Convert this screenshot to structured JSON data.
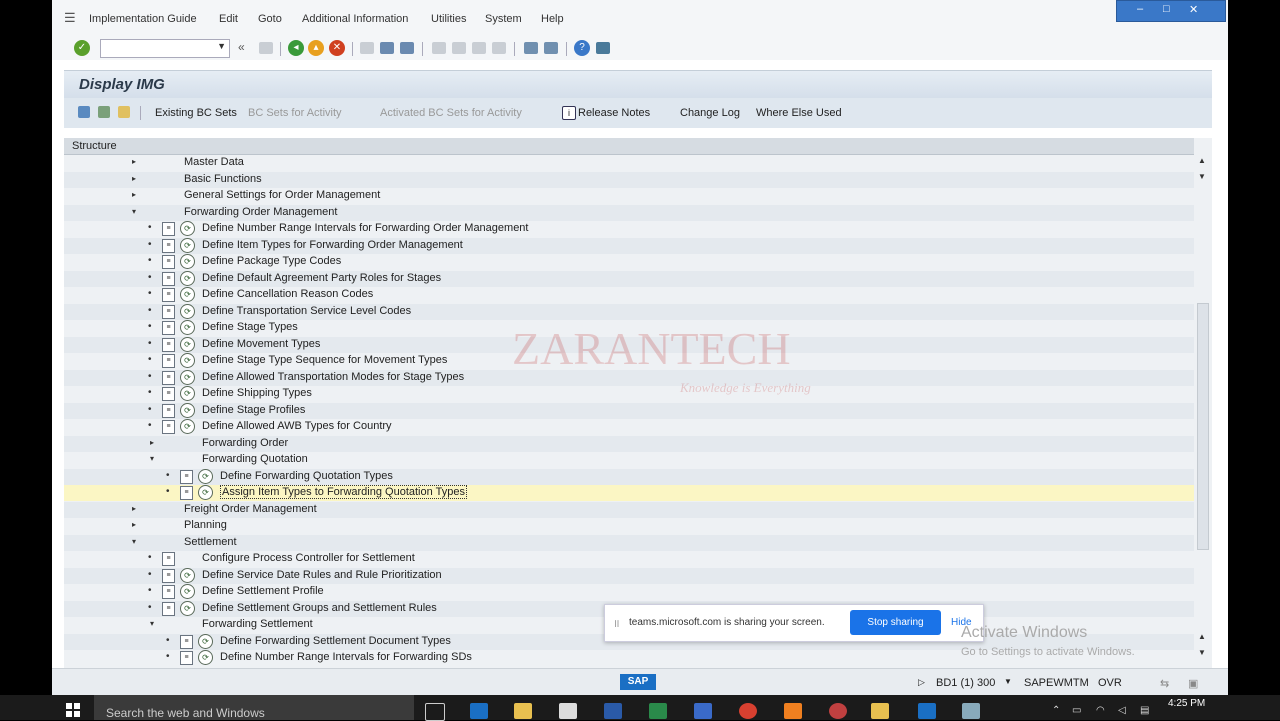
{
  "menu": [
    "Implementation Guide",
    "Edit",
    "Goto",
    "Additional Information",
    "Utilities",
    "System",
    "Help"
  ],
  "window_controls": [
    "–",
    "□",
    "✕"
  ],
  "title": "Display IMG",
  "app_toolbar": {
    "existing_bc_sets": "Existing BC Sets",
    "bc_sets_activity": "BC Sets for Activity",
    "activated_bc_sets": "Activated BC Sets for Activity",
    "release_notes": "Release Notes",
    "change_log": "Change Log",
    "where_else_used": "Where Else Used"
  },
  "structure_header": "Structure",
  "tree": [
    {
      "label": "Master Data",
      "toggle": "▸"
    },
    {
      "label": "Basic Functions",
      "toggle": "▸"
    },
    {
      "label": "General Settings for Order Management",
      "toggle": "▸"
    },
    {
      "label": "Forwarding Order Management",
      "toggle": "▾"
    },
    {
      "label": "Define Number Range Intervals for Forwarding Order Management"
    },
    {
      "label": "Define Item Types for Forwarding Order Management"
    },
    {
      "label": "Define Package Type Codes"
    },
    {
      "label": "Define Default Agreement Party Roles for Stages"
    },
    {
      "label": "Define Cancellation Reason Codes"
    },
    {
      "label": "Define Transportation Service Level Codes"
    },
    {
      "label": "Define Stage Types"
    },
    {
      "label": "Define Movement Types"
    },
    {
      "label": "Define Stage Type Sequence for Movement Types"
    },
    {
      "label": "Define Allowed Transportation Modes for Stage Types"
    },
    {
      "label": "Define Shipping Types"
    },
    {
      "label": "Define Stage Profiles"
    },
    {
      "label": "Define Allowed AWB Types for Country"
    },
    {
      "label": "Forwarding Order",
      "toggle": "▸"
    },
    {
      "label": "Forwarding Quotation",
      "toggle": "▾"
    },
    {
      "label": "Define Forwarding Quotation Types"
    },
    {
      "label": "Assign Item Types to Forwarding Quotation Types"
    },
    {
      "label": "Freight Order Management",
      "toggle": "▸"
    },
    {
      "label": "Planning",
      "toggle": "▸"
    },
    {
      "label": "Settlement",
      "toggle": "▾"
    },
    {
      "label": "Configure Process Controller for Settlement"
    },
    {
      "label": "Define Service Date Rules and Rule Prioritization"
    },
    {
      "label": "Define Settlement Profile"
    },
    {
      "label": "Define Settlement Groups and Settlement Rules"
    },
    {
      "label": "Forwarding Settlement",
      "toggle": "▾"
    },
    {
      "label": "Define Forwarding Settlement Document Types"
    },
    {
      "label": "Define Number Range Intervals for Forwarding SDs"
    }
  ],
  "watermark": {
    "brand": "ZARANTECH",
    "tagline": "Knowledge is Everything"
  },
  "status": {
    "sap_logo": "SAP",
    "system": "BD1 (1) 300",
    "server": "SAPEWMTM",
    "mode": "OVR"
  },
  "share_bar": {
    "message": "teams.microsoft.com is sharing your screen.",
    "stop": "Stop sharing",
    "hide": "Hide"
  },
  "activate_windows": {
    "title": "Activate Windows",
    "subtitle": "Go to Settings to activate Windows."
  },
  "taskbar": {
    "search_placeholder": "Search the web and Windows",
    "time": "4:25 PM"
  },
  "colors": {
    "selected_row": "#fbf6c4",
    "title_bar": "#d4deea",
    "share_button": "#1a73e8"
  }
}
